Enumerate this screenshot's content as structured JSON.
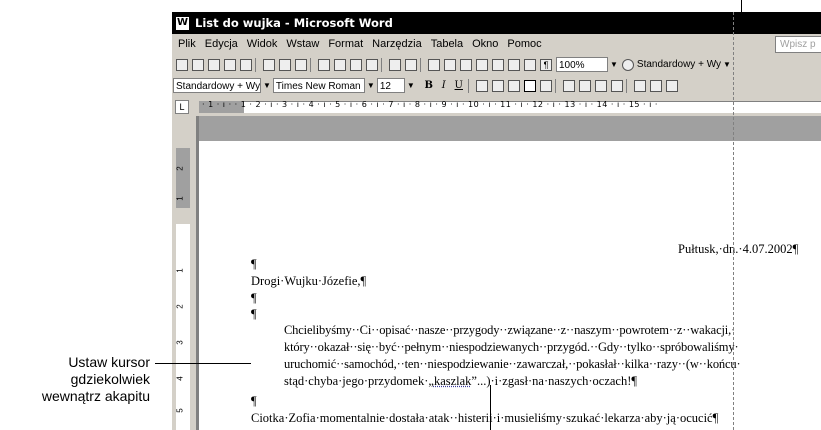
{
  "window": {
    "title": "List do wujka - Microsoft Word"
  },
  "menu": {
    "items": [
      "Plik",
      "Edycja",
      "Widok",
      "Wstaw",
      "Format",
      "Narzędzia",
      "Tabela",
      "Okno",
      "Pomoc"
    ],
    "help_placeholder": "Wpisz p"
  },
  "toolbar": {
    "zoom": "100%",
    "style_std": "Standardowy + Wy",
    "style_fmt": "Standardowy + Wy",
    "font": "Times New Roman",
    "size": "12",
    "bold": "B",
    "italic": "I",
    "underline": "U"
  },
  "ruler": {
    "labels": "· 1 · ı · · 1 · 2 · ı · 3 · ı · 4 · ı · 5 · ı · 6 · ı · 7 · ı · 8 · ı · 9 · ı · 10 · ı · 11 · ı · 12 · ı · 13 · ı · 14 · ı · 15 · ı ·",
    "tab_selector": "L",
    "v_labels": [
      "2",
      "1",
      "1",
      "2",
      "3",
      "4",
      "5"
    ]
  },
  "document": {
    "date_line": "Pułtusk,·dn.·4.07.2002¶",
    "pilcrow": "¶",
    "greeting": "Drogi·Wujku·Józefie,¶",
    "para_line1": "Chcielibyśmy··Ci··opisać··nasze··przygody··związane··z··naszym··powrotem··z··wakacji,·",
    "para_line2": "który··okazał··się··być··pełnym··niespodziewanych··przygód.··Gdy··tylko··spróbowaliśmy·",
    "para_line3": "uruchomić··samochód,··ten··niespodziewanie··zawarczał,··pokasłał··kilka··razy··(w··końcu·",
    "para_line4_a": "stąd·chyba·jego·przydomek·„",
    "para_line4_b": "kaszlak",
    "para_line4_c": "”...)·i·zgasł·na·naszych·oczach!¶",
    "last_line": "Ciotka·Zofia·momentalnie·dostała·atak··histerii·i·musieliśmy·szukać·lekarza·aby·ją·ocucić¶"
  },
  "callout": {
    "line1": "Ustaw kursor",
    "line2": "gdziekolwiek",
    "line3": "wewnątrz akapitu"
  }
}
